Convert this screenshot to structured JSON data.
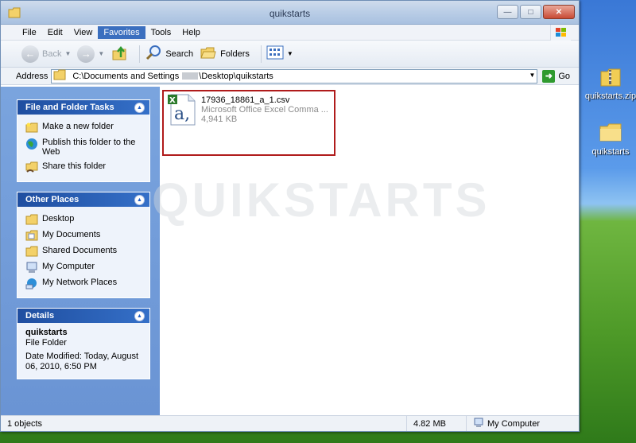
{
  "window": {
    "title": "quikstarts",
    "buttons": {
      "minimize": "—",
      "maximize": "□",
      "close": "✕"
    }
  },
  "menubar": {
    "items": [
      "File",
      "Edit",
      "View",
      "Favorites",
      "Tools",
      "Help"
    ],
    "active": "Favorites"
  },
  "toolbar": {
    "back_label": "Back",
    "search_label": "Search",
    "folders_label": "Folders"
  },
  "address": {
    "label": "Address",
    "value_prefix": "C:\\Documents and Settings",
    "value_suffix": "\\Desktop\\quikstarts",
    "go_label": "Go"
  },
  "sidebar": {
    "file_tasks": {
      "title": "File and Folder Tasks",
      "items": [
        {
          "label": "Make a new folder",
          "icon": "new-folder-icon"
        },
        {
          "label": "Publish this folder to the Web",
          "icon": "globe-icon"
        },
        {
          "label": "Share this folder",
          "icon": "share-icon"
        }
      ]
    },
    "other_places": {
      "title": "Other Places",
      "items": [
        {
          "label": "Desktop",
          "icon": "folder-icon"
        },
        {
          "label": "My Documents",
          "icon": "folder-icon"
        },
        {
          "label": "Shared Documents",
          "icon": "folder-icon"
        },
        {
          "label": "My Computer",
          "icon": "computer-icon"
        },
        {
          "label": "My Network Places",
          "icon": "network-icon"
        }
      ]
    },
    "details": {
      "title": "Details",
      "name": "quikstarts",
      "type": "File Folder",
      "modified_line1": "Date Modified: Today, August",
      "modified_line2": "06, 2010, 6:50 PM"
    }
  },
  "files": [
    {
      "name": "17936_18861_a_1.csv",
      "type": "Microsoft Office Excel Comma ...",
      "size": "4,941 KB",
      "icon": "excel-csv-icon"
    }
  ],
  "watermark": "QUIKSTARTS",
  "statusbar": {
    "objects": "1 objects",
    "size": "4.82 MB",
    "location": "My Computer"
  },
  "desktop": {
    "icons": [
      {
        "label": "quikstarts.zip",
        "icon": "zip-folder-icon"
      },
      {
        "label": "quikstarts",
        "icon": "folder-icon"
      }
    ]
  },
  "colors": {
    "accent": "#3b6fbf",
    "highlight": "#b01b1b",
    "sidebar": "#6a94d4"
  }
}
